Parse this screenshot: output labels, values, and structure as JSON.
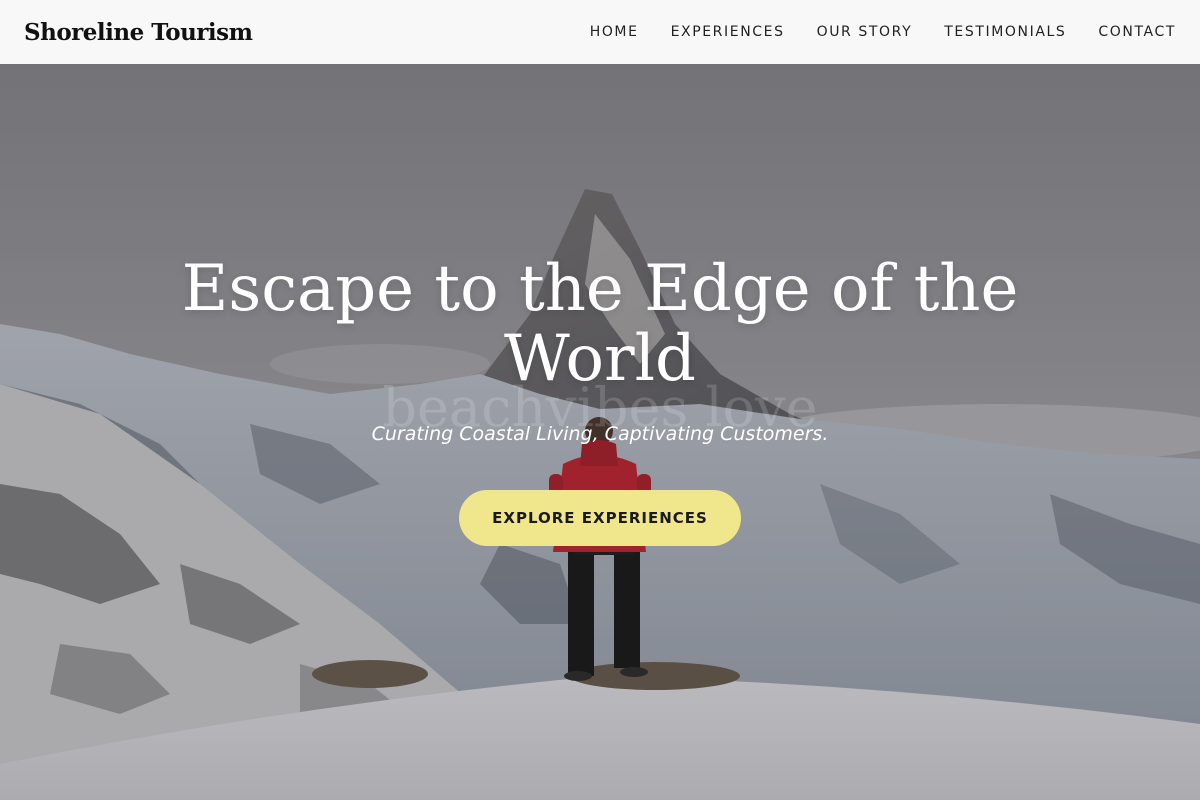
{
  "header": {
    "logo": "Shoreline Tourism",
    "nav": [
      {
        "label": "HOME"
      },
      {
        "label": "EXPERIENCES"
      },
      {
        "label": "OUR STORY"
      },
      {
        "label": "TESTIMONIALS"
      },
      {
        "label": "CONTACT"
      }
    ]
  },
  "hero": {
    "title": "Escape to the Edge of the World",
    "watermark": "beachvibes love",
    "tagline": "Curating Coastal Living, Captivating Customers.",
    "cta_label": "EXPLORE EXPERIENCES",
    "background_image": "snowy-mountain-hiker-photo"
  },
  "colors": {
    "header_bg": "#f8f8f8",
    "cta_bg": "#f0e68c",
    "hero_text": "#ffffff",
    "hiker_jacket": "#c8202e"
  }
}
